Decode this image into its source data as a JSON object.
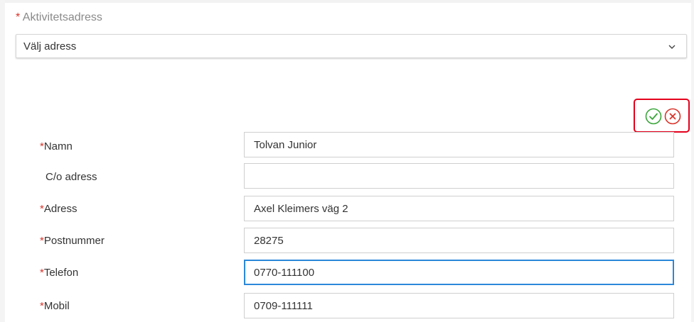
{
  "activity_address": {
    "required_mark": "*",
    "label": "Aktivitetsadress",
    "select_value": "Välj adress"
  },
  "actions": {
    "confirm_icon": "check-circle-icon",
    "cancel_icon": "close-circle-icon",
    "confirm_color": "#3aa53a",
    "cancel_color": "#d9342b",
    "highlight_color": "#e3001b"
  },
  "form": {
    "fields": [
      {
        "required": "*",
        "label": "Namn",
        "value": "Tolvan Junior"
      },
      {
        "required": "",
        "label": "C/o adress",
        "value": ""
      },
      {
        "required": "*",
        "label": "Adress",
        "value": "Axel Kleimers väg 2"
      },
      {
        "required": "*",
        "label": "Postnummer",
        "value": "28275"
      },
      {
        "required": "*",
        "label": "Telefon",
        "value": "0770-111100"
      },
      {
        "required": "*",
        "label": "Mobil",
        "value": "0709-111111"
      }
    ]
  },
  "focus_color": "#2b88d9"
}
